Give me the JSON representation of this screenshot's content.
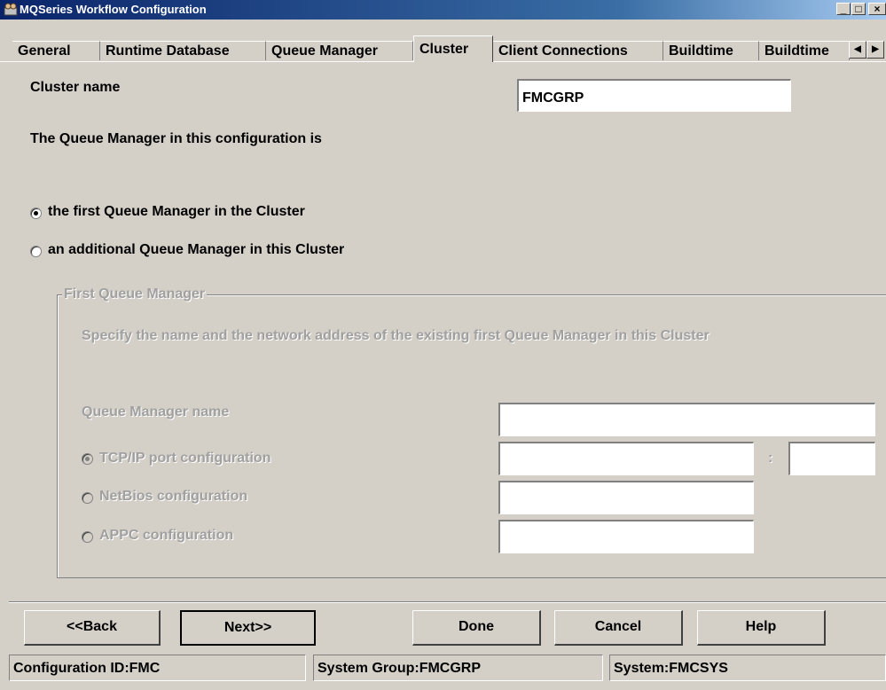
{
  "window": {
    "title": "MQSeries Workflow Configuration",
    "icon": "workflow-app-icon",
    "controls": {
      "minimize": "_",
      "maximize": "□",
      "close": "×"
    }
  },
  "tabs": [
    {
      "label": "General"
    },
    {
      "label": "Runtime Database"
    },
    {
      "label": "Queue Manager"
    },
    {
      "label": "Cluster",
      "active": true
    },
    {
      "label": "Client Connections"
    },
    {
      "label": "Buildtime"
    },
    {
      "label": "Buildtime"
    }
  ],
  "tab_scroll": {
    "left": "◀",
    "right": "▶"
  },
  "cluster": {
    "name_label": "Cluster name",
    "name_value": "FMCGRP",
    "qm_statement": "The Queue Manager in this configuration is",
    "option_first": "the first Queue Manager in the Cluster",
    "option_additional": "an additional Queue Manager in this Cluster",
    "selected_option": "first"
  },
  "first_qm_group": {
    "legend": "First Queue Manager",
    "instructions": "Specify the name and the network address of the existing first Queue Manager in this Cluster",
    "qm_name_label": "Queue Manager name",
    "qm_name_value": "",
    "tcpip_label": "TCP/IP port configuration",
    "tcpip_value": "",
    "port_separator": ":",
    "port_value": "",
    "netbios_label": "NetBios configuration",
    "netbios_value": "",
    "appc_label": "APPC configuration",
    "appc_value": "",
    "selected_protocol": "tcpip"
  },
  "buttons": {
    "back": "<<Back",
    "next": "Next>>",
    "done": "Done",
    "cancel": "Cancel",
    "help": "Help"
  },
  "status": {
    "config_id": "Configuration ID:FMC",
    "system_group": "System Group:FMCGRP",
    "system": "System:FMCSYS"
  }
}
